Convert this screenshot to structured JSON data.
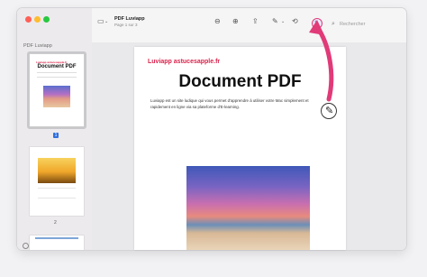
{
  "window": {
    "doc_title": "PDF Luviapp",
    "doc_subtitle": "Page 1 sur 3",
    "search_placeholder": "Rechercher"
  },
  "sidebar": {
    "title": "PDF Luviapp",
    "pages": [
      {
        "label": "1",
        "selected": true
      },
      {
        "label": "2",
        "selected": false
      }
    ],
    "thumb1": {
      "brand": "Luviapp astucesapple.fr",
      "title": "Document PDF"
    }
  },
  "document": {
    "brand": "Luviapp astucesapple.fr",
    "title": "Document PDF",
    "paragraph": "Luviapp est un site ludique qui vous permet d'apprendre à utiliser votre Mac simplement et rapidement en ligne via sa plateforme d'E-learning."
  },
  "icons": {
    "markup": "markup-icon",
    "pencil": "pencil-icon"
  },
  "colors": {
    "accent_pink": "#e13a78",
    "brand_red": "#d9234c",
    "selection_blue": "#2f6fe0"
  }
}
